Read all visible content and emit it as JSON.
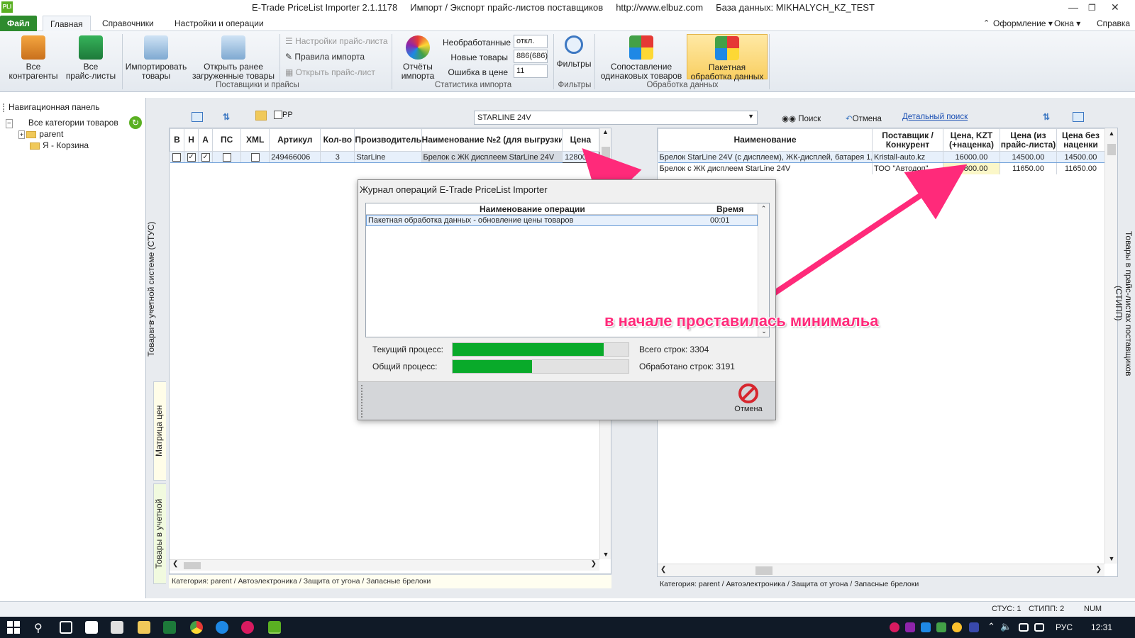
{
  "titlebar": {
    "text": "E-Trade PriceList Importer 2.1.1178     Импорт / Экспорт прайс-листов поставщиков     http://www.elbuz.com     База данных: MIKHALYCH_KZ_TEST",
    "app_icon": "PLI"
  },
  "menu": {
    "file": "Файл",
    "tabs": [
      "Главная",
      "Справочники",
      "Настройки и операции"
    ],
    "right": [
      "Оформление",
      "Окна",
      "Справка"
    ]
  },
  "ribbon": {
    "all_contractors": "Все\nконтрагенты",
    "all_pricelists": "Все\nпрайс-листы",
    "import_goods": "Импортировать\nтовары",
    "open_loaded": "Открыть ранее\nзагруженные товары",
    "pricelist_settings": "Настройки прайс-листа",
    "import_rules": "Правила импорта",
    "open_pricelist": "Открыть прайс-лист",
    "group_suppliers": "Поставщики и прайсы",
    "import_reports": "Отчёты\nимпорта",
    "stat_unprocessed_label": "Необработанные",
    "stat_unprocessed_value": "откл.",
    "stat_new_label": "Новые товары",
    "stat_new_value": "886(686)",
    "stat_error_label": "Ошибка в цене",
    "stat_error_value": "11",
    "group_stats": "Статистика импорта",
    "filters": "Фильтры",
    "group_filters": "Фильтры",
    "match_goods": "Сопоставление\nодинаковых товаров",
    "batch": "Пакетная\nобработка данных",
    "group_data": "Обработка данных"
  },
  "nav": {
    "header": "Навигационная панель",
    "items": [
      "Все категории товаров",
      "parent",
      "Я - Корзина"
    ]
  },
  "left_tabs": {
    "top": "Товары в учетной системе (СТУС)",
    "matrix": "Матрица цен контрагентов",
    "accounting": "Товары в учетной системе"
  },
  "right_tab": "Товары в прайс-листах поставщиков (СТИПП)",
  "toolbar": {
    "pp_label": "PP",
    "search_value": "STARLINE 24V",
    "search_btn": "Поиск",
    "cancel_btn": "Отмена",
    "detailed_search": "Детальный поиск"
  },
  "left_table": {
    "headers": [
      "В",
      "Н",
      "А",
      "ПС",
      "XML",
      "Артикул",
      "Кол-во",
      "Производитель",
      "Наименование №2 (для выгрузки)",
      "Цена"
    ],
    "row": {
      "b": false,
      "n": true,
      "a": true,
      "ps": false,
      "xml": false,
      "article": "249466006",
      "qty": "3",
      "maker": "StarLine",
      "name2": "Брелок с ЖК дисплеем StarLine 24V",
      "price": "12800.00"
    },
    "footer": "Категория: parent / Автоэлектроника / Защита от угона / Запасные брелоки"
  },
  "right_table": {
    "headers": [
      "Наименование",
      "Поставщик / Конкурент",
      "Цена, KZT (+наценка)",
      "Цена (из прайс-листа)",
      "Цена без наценки"
    ],
    "rows": [
      {
        "name": "Брелок StarLine 24V (с дисплеем), ЖК-дисплей, батарея 1,",
        "supplier": "Kristall-auto.kz",
        "price_kzt": "16000.00",
        "price_list": "14500.00",
        "price_raw": "14500.00"
      },
      {
        "name": "Брелок с ЖК дисплеем  StarLine  24V",
        "supplier": "ТОО \"Автодоп\"",
        "price_kzt": "12800.00",
        "price_list": "11650.00",
        "price_raw": "11650.00"
      }
    ],
    "footer": "Категория: parent / Автоэлектроника / Защита от угона / Запасные брелоки"
  },
  "dialog": {
    "title": "Журнал операций E-Trade PriceList Importer",
    "col_op": "Наименование операции",
    "col_time": "Время",
    "op": "Пакетная обработка данных - обновление цены товаров",
    "time": "00:01",
    "current_label": "Текущий процесс:",
    "total_label": "Общий процесс:",
    "current_progress": 0.86,
    "total_progress": 0.45,
    "total_rows": "Всего строк: 3304",
    "processed_rows": "Обработано строк: 3191",
    "cancel": "Отмена"
  },
  "annotation": "в начале проставилась минимальа",
  "status": {
    "stus": "СТУС: 1",
    "stipp": "СТИПП: 2",
    "num": "NUM"
  },
  "taskbar": {
    "lang": "РУС",
    "time": "12:31"
  },
  "colors": {
    "accent_pink": "#ff2a7a",
    "progress_green": "#09aa2a",
    "file_tab": "#2e8b2e",
    "batch_highlight": "#fbd872"
  }
}
